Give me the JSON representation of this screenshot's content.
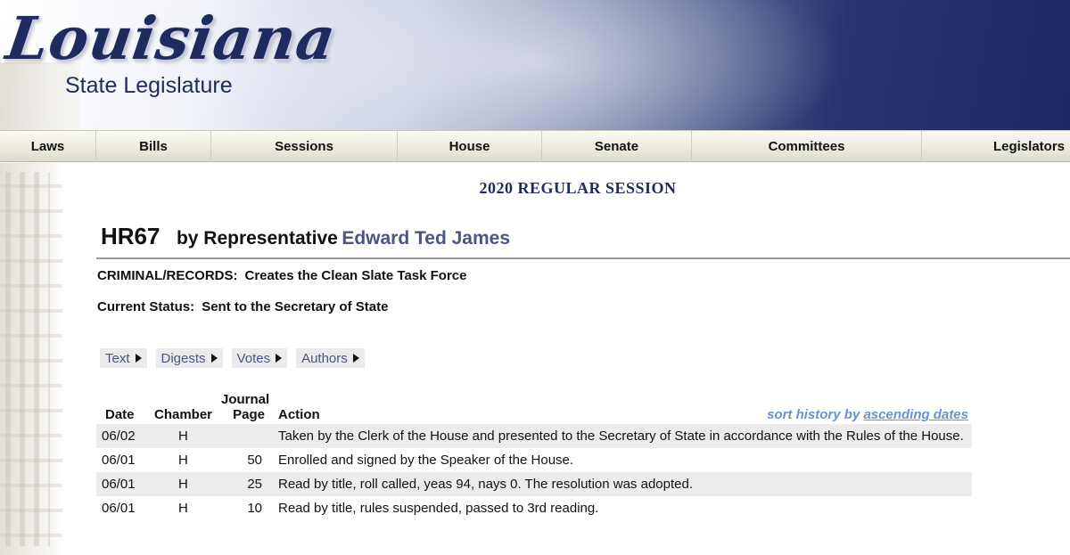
{
  "header": {
    "logo_main": "Louisiana",
    "logo_sub": "State Legislature"
  },
  "nav": {
    "items": [
      {
        "label": "Laws"
      },
      {
        "label": "Bills"
      },
      {
        "label": "Sessions"
      },
      {
        "label": "House"
      },
      {
        "label": "Senate"
      },
      {
        "label": "Committees"
      },
      {
        "label": "Legislators"
      }
    ]
  },
  "session": "2020 REGULAR SESSION",
  "bill": {
    "number": "HR67",
    "by_text": "by Representative",
    "author": "Edward Ted James",
    "subject_label": "CRIMINAL/RECORDS:",
    "subject": "Creates the Clean Slate Task Force",
    "status_label": "Current Status:",
    "status": "Sent to the Secretary of State"
  },
  "tabs": [
    {
      "label": "Text"
    },
    {
      "label": "Digests"
    },
    {
      "label": "Votes"
    },
    {
      "label": "Authors"
    }
  ],
  "history": {
    "headers": {
      "date": "Date",
      "chamber": "Chamber",
      "journal_1": "Journal",
      "journal_2": "Page",
      "action": "Action"
    },
    "sort_prefix": "sort history by",
    "sort_link": "ascending dates",
    "rows": [
      {
        "date": "06/02",
        "chamber": "H",
        "page": "",
        "action": "Taken by the Clerk of the House and presented to the Secretary of State in accordance with the Rules of the House."
      },
      {
        "date": "06/01",
        "chamber": "H",
        "page": "50",
        "action": "Enrolled and signed by the Speaker of the House."
      },
      {
        "date": "06/01",
        "chamber": "H",
        "page": "25",
        "action": "Read by title, roll called, yeas 94, nays 0. The resolution was adopted."
      },
      {
        "date": "06/01",
        "chamber": "H",
        "page": "10",
        "action": "Read by title, rules suspended, passed to 3rd reading."
      }
    ]
  },
  "colors": {
    "brand_navy": "#1f2a5e",
    "link_blue": "#4a5488",
    "sort_blue": "#6c8fd0",
    "row_shade": "#ececec"
  }
}
